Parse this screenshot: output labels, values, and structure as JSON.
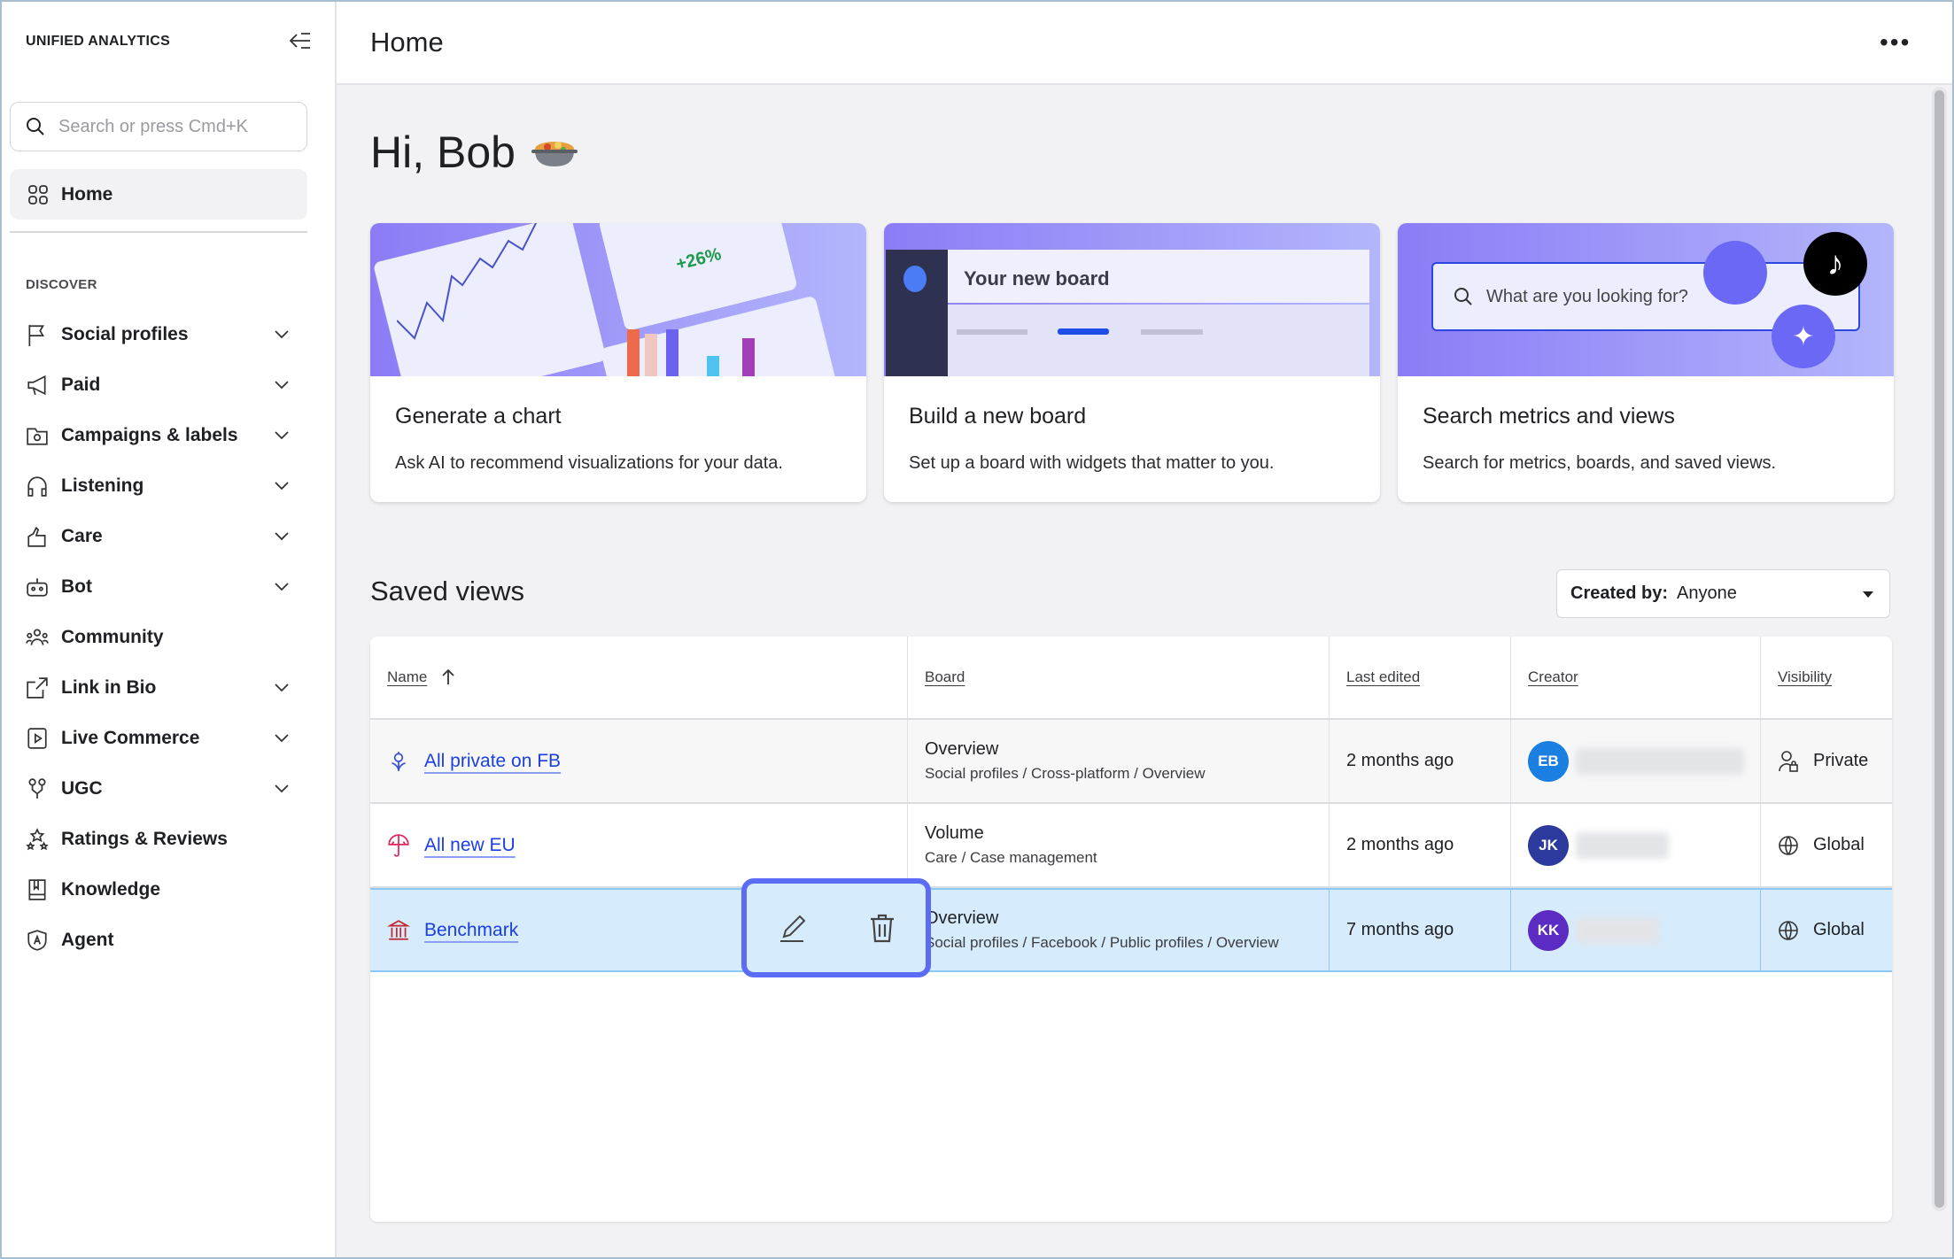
{
  "sidebar": {
    "brand": "UNIFIED ANALYTICS",
    "search_placeholder": "Search or press Cmd+K",
    "home": "Home",
    "section": "DISCOVER",
    "items": [
      {
        "label": "Social profiles",
        "icon": "flag-icon",
        "expandable": true
      },
      {
        "label": "Paid",
        "icon": "megaphone-icon",
        "expandable": true
      },
      {
        "label": "Campaigns & labels",
        "icon": "folder-icon",
        "expandable": true
      },
      {
        "label": "Listening",
        "icon": "headphones-icon",
        "expandable": true
      },
      {
        "label": "Care",
        "icon": "care-icon",
        "expandable": true
      },
      {
        "label": "Bot",
        "icon": "bot-icon",
        "expandable": true
      },
      {
        "label": "Community",
        "icon": "people-icon",
        "expandable": false
      },
      {
        "label": "Link in Bio",
        "icon": "link-icon",
        "expandable": true
      },
      {
        "label": "Live Commerce",
        "icon": "play-icon",
        "expandable": true
      },
      {
        "label": "UGC",
        "icon": "ugc-icon",
        "expandable": true
      },
      {
        "label": "Ratings & Reviews",
        "icon": "stars-icon",
        "expandable": false
      },
      {
        "label": "Knowledge",
        "icon": "book-icon",
        "expandable": false
      },
      {
        "label": "Agent",
        "icon": "shield-icon",
        "expandable": false
      }
    ]
  },
  "header": {
    "title": "Home"
  },
  "greeting": "Hi, Bob",
  "cards": [
    {
      "title": "Generate a chart",
      "desc": "Ask AI to recommend visualizations for your data.",
      "art_text": "+26%"
    },
    {
      "title": "Build a new board",
      "desc": "Set up a board with widgets that matter to you.",
      "art_text": "Your new board"
    },
    {
      "title": "Search metrics and views",
      "desc": "Search for metrics, boards, and saved views.",
      "art_text": "What are you looking for?"
    }
  ],
  "saved_views": {
    "title": "Saved views",
    "filter_label": "Created by:",
    "filter_value": "Anyone",
    "columns": [
      "Name",
      "Board",
      "Last edited",
      "Creator",
      "Visibility"
    ],
    "rows": [
      {
        "name": "All private on FB",
        "board": "Overview",
        "path": "Social profiles / Cross-platform / Overview",
        "edited": "2 months ago",
        "initials": "EB",
        "avatar_color": "#1a7fe0",
        "visibility": "Private",
        "icon_color": "#3a4fd8"
      },
      {
        "name": "All new EU",
        "board": "Volume",
        "path": "Care / Case management",
        "edited": "2 months ago",
        "initials": "JK",
        "avatar_color": "#2c3a9e",
        "visibility": "Global",
        "icon_color": "#e0245e"
      },
      {
        "name": "Benchmark",
        "board": "Overview",
        "path": "Social profiles / Facebook / Public profiles / Overview",
        "edited": "7 months ago",
        "initials": "KK",
        "avatar_color": "#5b2bc4",
        "visibility": "Global",
        "icon_color": "#c0282d"
      }
    ]
  },
  "colors": {
    "accent": "#1b3fe0",
    "highlight_row": "#d6ebfc",
    "action_outline": "#5a6cf6"
  }
}
